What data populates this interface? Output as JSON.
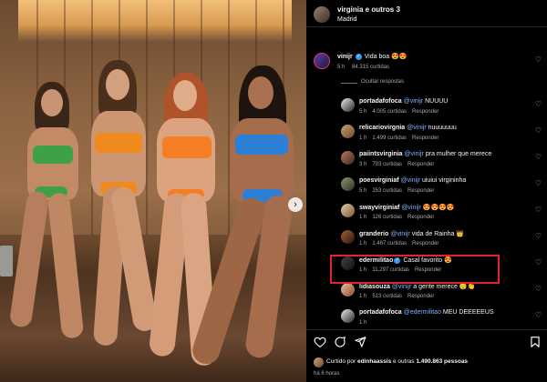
{
  "header": {
    "title": "virginia e outros 3",
    "subtitle": "Madrid"
  },
  "top_comment": {
    "user": "vinijr",
    "verified": true,
    "text": "Vida boa 😍😍",
    "time": "5 h",
    "likes": "84.315 curtidas"
  },
  "hide_replies": "Ocultar respostas",
  "replies": [
    {
      "user": "portadafofoca",
      "verified": false,
      "mention": "@vinijr",
      "text": "NUUUU",
      "time": "5 h",
      "likes": "4.005 curtidas",
      "reply": "Responder"
    },
    {
      "user": "relicariovirgnia",
      "verified": false,
      "mention": "@vinijr",
      "text": "nuuuuuuu",
      "time": "1 h",
      "likes": "1.499 curtidas",
      "reply": "Responder"
    },
    {
      "user": "paiintsvirginia",
      "verified": false,
      "mention": "@vinijr",
      "text": "pra mulher que merece",
      "time": "3 h",
      "likes": "793 curtidas",
      "reply": "Responder"
    },
    {
      "user": "poesvirginiaf",
      "verified": false,
      "mention": "@vinijr",
      "text": "uiuiui virgininha",
      "time": "5 h",
      "likes": "253 curtidas",
      "reply": "Responder"
    },
    {
      "user": "swayvirginiaf",
      "verified": false,
      "mention": "@vinijr",
      "text": "😍😍😍😍",
      "time": "1 h",
      "likes": "126 curtidas",
      "reply": "Responder"
    },
    {
      "user": "granderio",
      "verified": false,
      "mention": "@vinijr",
      "text": "vida de Rainha 👑",
      "time": "1 h",
      "likes": "1.487 curtidas",
      "reply": "Responder"
    },
    {
      "user": "edermilitao",
      "verified": true,
      "mention": "",
      "text": "Casal favorito 😍",
      "time": "1 h",
      "likes": "11.297 curtidas",
      "reply": "Responder"
    },
    {
      "user": "lidiasouza",
      "verified": false,
      "mention": "@vinijr",
      "text": "a gente merece 😌👏",
      "time": "1 h",
      "likes": "513 curtidas",
      "reply": "Responder"
    },
    {
      "user": "portadafofoca",
      "verified": false,
      "mention": "@edermilitao",
      "text": "MEU DEEEEEUS",
      "time": "1 h",
      "likes": "",
      "reply": ""
    }
  ],
  "liked_by": {
    "prefix": "Curtido por",
    "user": "edinhaassis",
    "middle": "e outras",
    "count": "1.490.863 pessoas"
  },
  "time_ago": "há 6 horas",
  "icons": {
    "like": "heart-icon",
    "comment": "comment-icon",
    "share": "share-icon",
    "save": "bookmark-icon",
    "next": "chevron-right-icon"
  },
  "colors": {
    "background": "#000000",
    "mention": "#7fb3ff",
    "verified": "#3897f0",
    "highlight": "#e3242b"
  }
}
